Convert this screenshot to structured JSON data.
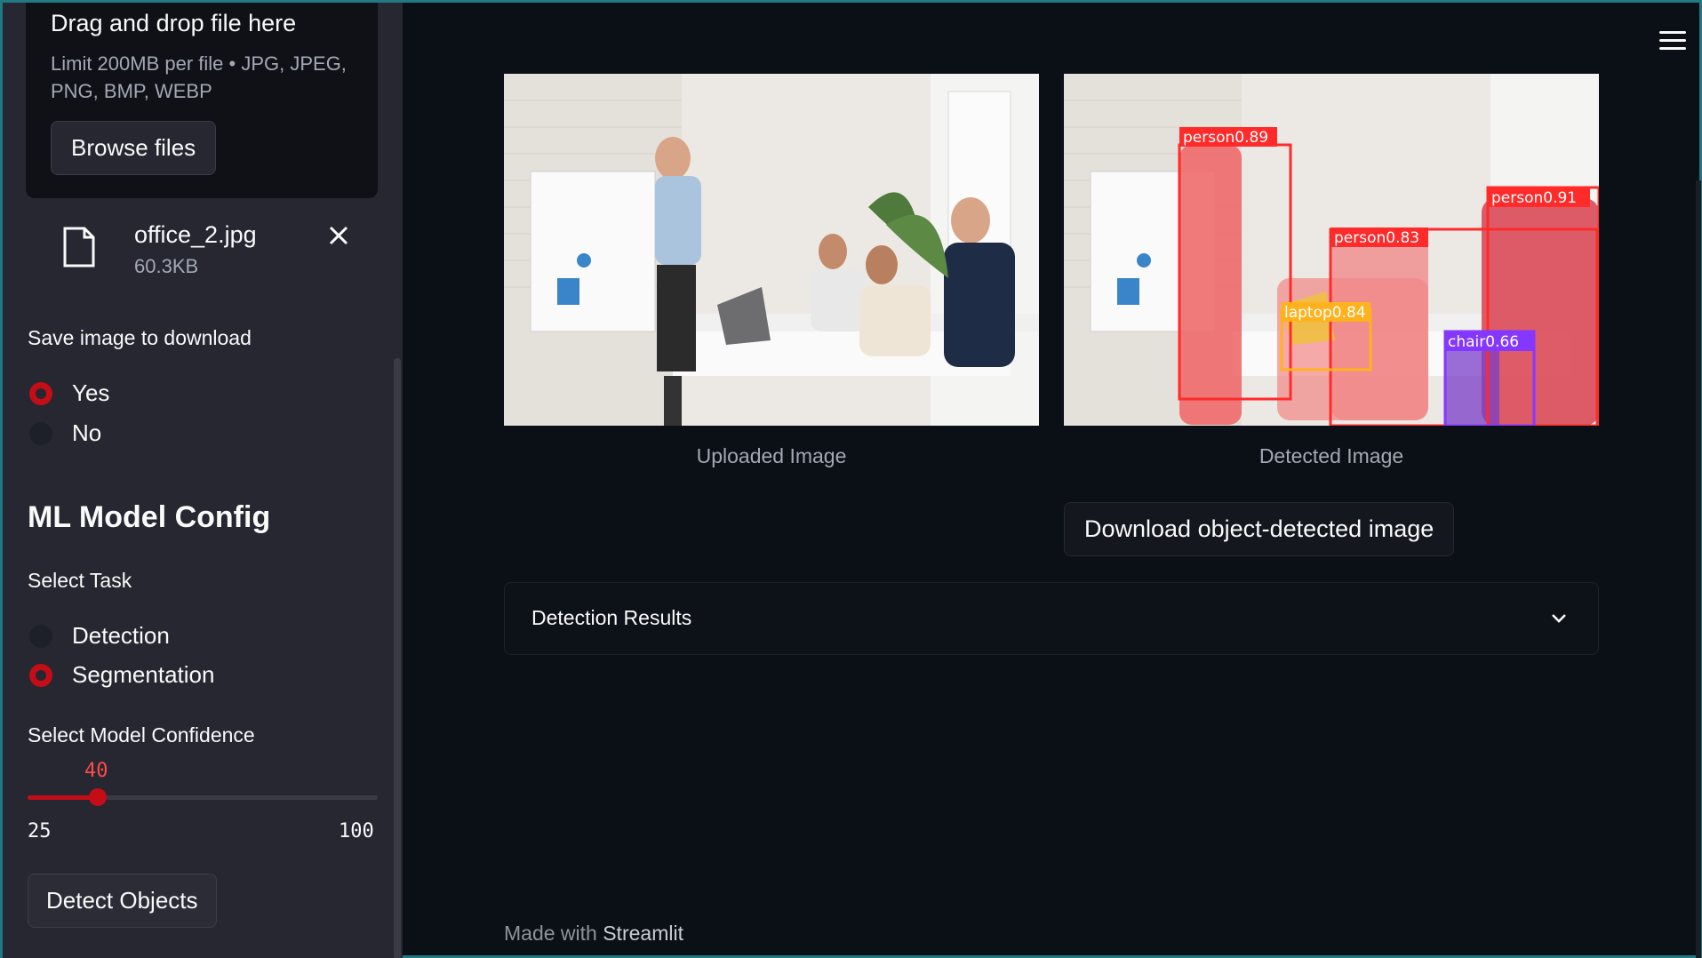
{
  "sidebar": {
    "uploader": {
      "title": "Drag and drop file here",
      "limit": "Limit 200MB per file • JPG, JPEG, PNG, BMP, WEBP",
      "browse_label": "Browse files"
    },
    "file": {
      "name": "office_2.jpg",
      "size": "60.3KB"
    },
    "save_image": {
      "label": "Save image to download",
      "options": [
        "Yes",
        "No"
      ],
      "selected": "Yes"
    },
    "config_title": "ML Model Config",
    "task": {
      "label": "Select Task",
      "options": [
        "Detection",
        "Segmentation"
      ],
      "selected": "Segmentation"
    },
    "confidence": {
      "label": "Select Model Confidence",
      "value": "40",
      "min": "25",
      "max": "100",
      "fraction": 0.2
    },
    "detect_label": "Detect Objects"
  },
  "main": {
    "uploaded_caption": "Uploaded Image",
    "detected_caption": "Detected Image",
    "detections": [
      {
        "label": "person0.89",
        "color": "#ff3838"
      },
      {
        "label": "person0.91",
        "color": "#ff3838"
      },
      {
        "label": "person0.83",
        "color": "#ff3838"
      },
      {
        "label": "laptop0.84",
        "color": "#ffb21d"
      },
      {
        "label": "chair0.66",
        "color": "#8438ff"
      }
    ],
    "download_label": "Download object-detected image",
    "expander_label": "Detection Results"
  },
  "footer": {
    "prefix": "Made with ",
    "brand": "Streamlit"
  },
  "colors": {
    "accent": "#ff4b4b",
    "sidebar_bg": "#262730",
    "main_bg": "#0e1117"
  }
}
